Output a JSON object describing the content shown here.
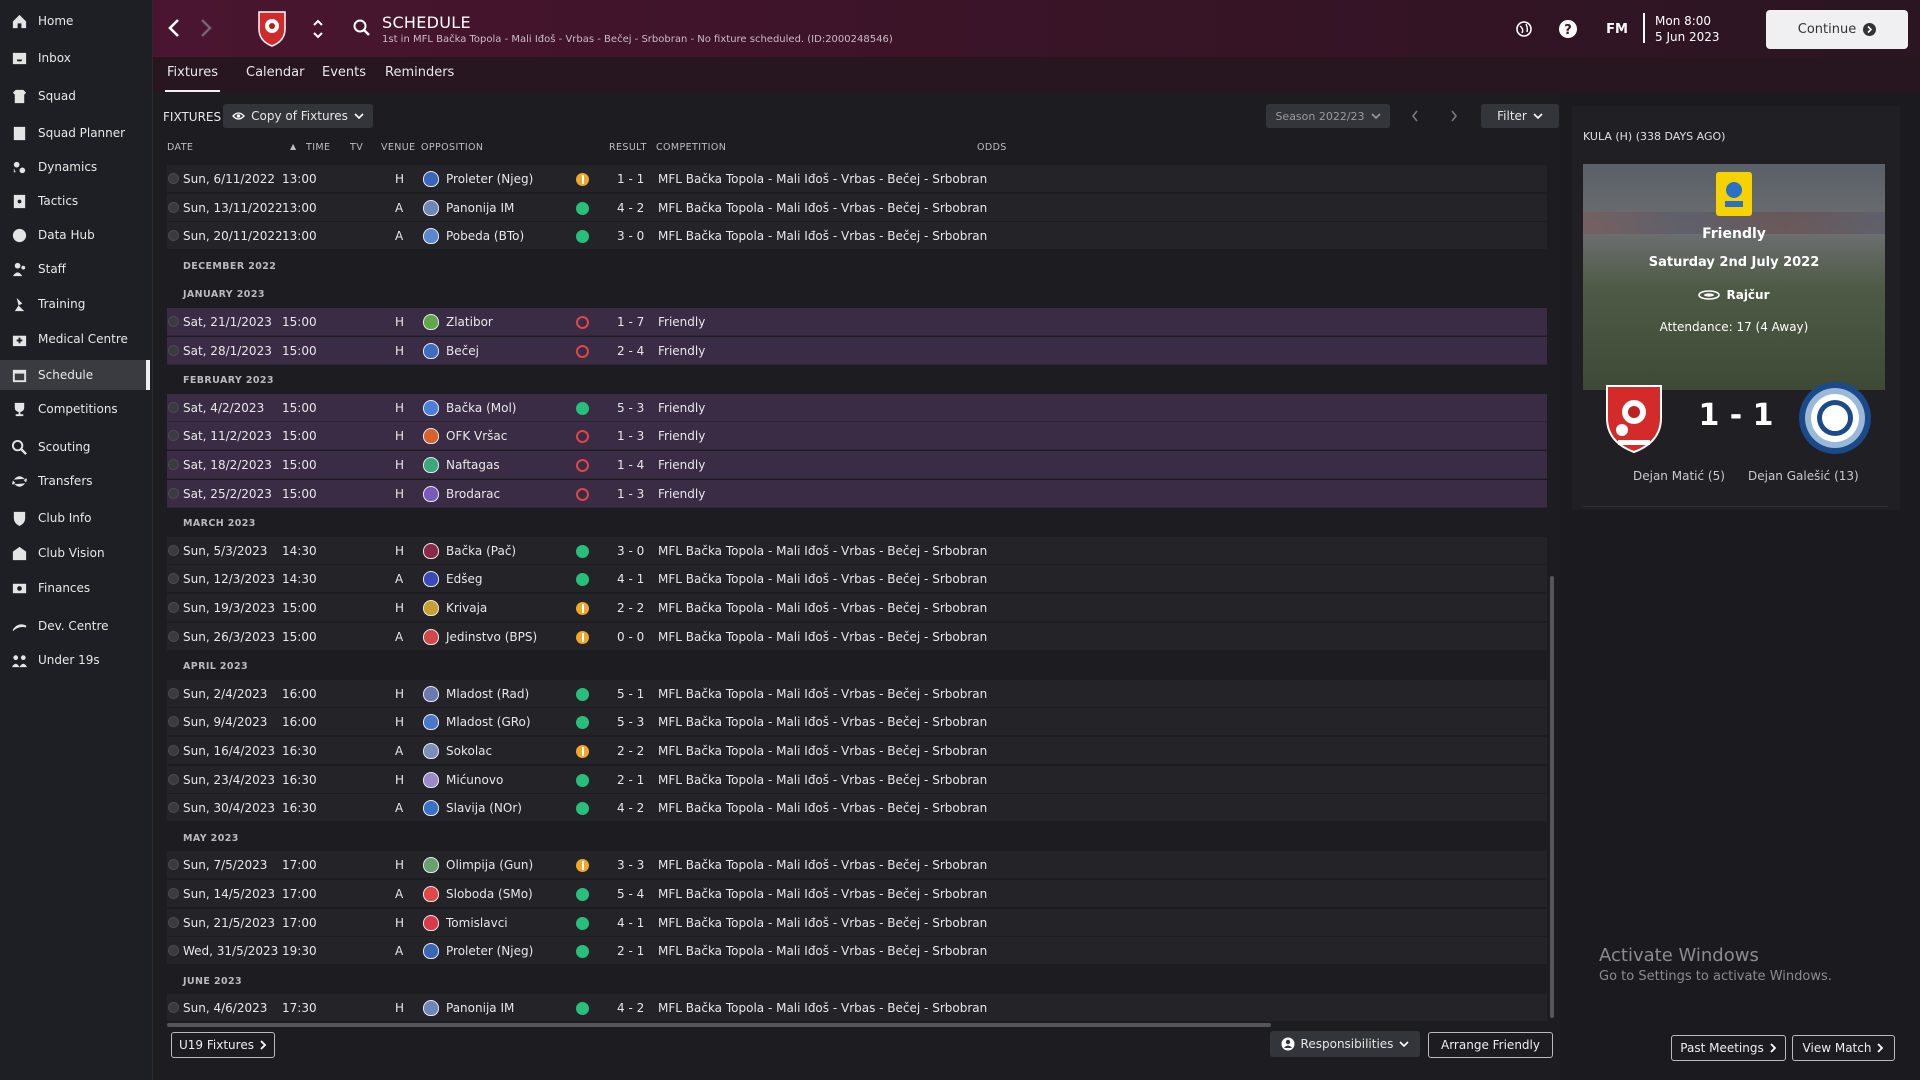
{
  "sidebar": {
    "items": [
      {
        "label": "Home",
        "icon": "home-icon"
      },
      {
        "label": "Inbox",
        "icon": "inbox-icon"
      },
      {
        "label": "Squad",
        "icon": "squad-icon"
      },
      {
        "label": "Squad Planner",
        "icon": "planner-icon"
      },
      {
        "label": "Dynamics",
        "icon": "dynamics-icon"
      },
      {
        "label": "Tactics",
        "icon": "tactics-icon"
      },
      {
        "label": "Data Hub",
        "icon": "data-hub-icon"
      },
      {
        "label": "Staff",
        "icon": "staff-icon"
      },
      {
        "label": "Training",
        "icon": "training-icon"
      },
      {
        "label": "Medical Centre",
        "icon": "medical-icon"
      },
      {
        "label": "Schedule",
        "icon": "schedule-icon",
        "active": true
      },
      {
        "label": "Competitions",
        "icon": "trophy-icon"
      },
      {
        "label": "Scouting",
        "icon": "scouting-icon"
      },
      {
        "label": "Transfers",
        "icon": "transfers-icon"
      },
      {
        "label": "Club Info",
        "icon": "club-info-icon"
      },
      {
        "label": "Club Vision",
        "icon": "club-vision-icon"
      },
      {
        "label": "Finances",
        "icon": "finances-icon"
      },
      {
        "label": "Dev. Centre",
        "icon": "dev-centre-icon"
      },
      {
        "label": "Under 19s",
        "icon": "under19-icon"
      }
    ]
  },
  "header": {
    "title": "SCHEDULE",
    "subtitle": "1st in MFL Bačka Topola - Mali Iđoš - Vrbas - Bečej - Srbobran - No fixture scheduled. (ID:2000248546)",
    "fm_label": "FM",
    "date_line1": "Mon 8:00",
    "date_line2": "5 Jun 2023",
    "continue_label": "Continue"
  },
  "tabs": [
    "Fixtures",
    "Calendar",
    "Events",
    "Reminders"
  ],
  "toolbar": {
    "fixtures_label": "FIXTURES",
    "view_select": "Copy of Fixtures",
    "season_select": "Season 2022/23",
    "filter_label": "Filter"
  },
  "columns": {
    "date": "DATE",
    "time": "TIME",
    "tv": "TV",
    "venue": "VENUE",
    "opposition": "OPPOSITION",
    "result": "RESULT",
    "competition": "COMPETITION",
    "odds": "ODDS"
  },
  "rows": [
    {
      "kind": "fixture",
      "date": "Sun, 6/11/2022",
      "time": "13:00",
      "venue": "H",
      "opp": "Proleter (Njeg)",
      "badge": "#3a66b8",
      "outcome": "draw",
      "score": "1 - 1",
      "comp": "MFL Bačka Topola - Mali Iđoš - Vrbas - Bečej - Srbobran"
    },
    {
      "kind": "fixture",
      "date": "Sun, 13/11/2022",
      "time": "13:00",
      "venue": "A",
      "opp": "Panonija IM",
      "badge": "#6f86b8",
      "outcome": "win",
      "score": "4 - 2",
      "comp": "MFL Bačka Topola - Mali Iđoš - Vrbas - Bečej - Srbobran"
    },
    {
      "kind": "fixture",
      "date": "Sun, 20/11/2022",
      "time": "13:00",
      "venue": "A",
      "opp": "Pobeda (BTo)",
      "badge": "#5a88d0",
      "outcome": "win",
      "score": "3 - 0",
      "comp": "MFL Bačka Topola - Mali Iđoš - Vrbas - Bečej - Srbobran"
    },
    {
      "kind": "month",
      "label": "DECEMBER 2022"
    },
    {
      "kind": "month",
      "label": "JANUARY 2023"
    },
    {
      "kind": "friendly",
      "date": "Sat, 21/1/2023",
      "time": "15:00",
      "venue": "H",
      "opp": "Zlatibor",
      "badge": "#5ea84a",
      "outcome": "loss",
      "score": "1 - 7",
      "comp": "Friendly"
    },
    {
      "kind": "friendly",
      "date": "Sat, 28/1/2023",
      "time": "15:00",
      "venue": "H",
      "opp": "Bečej",
      "badge": "#3f6cc0",
      "outcome": "loss",
      "score": "2 - 4",
      "comp": "Friendly"
    },
    {
      "kind": "month",
      "label": "FEBRUARY 2023"
    },
    {
      "kind": "friendly",
      "date": "Sat, 4/2/2023",
      "time": "15:00",
      "venue": "H",
      "opp": "Bačka (Mol)",
      "badge": "#4a80d8",
      "outcome": "win",
      "score": "5 - 3",
      "comp": "Friendly"
    },
    {
      "kind": "friendly",
      "date": "Sat, 11/2/2023",
      "time": "15:00",
      "venue": "H",
      "opp": "OFK Vršac",
      "badge": "#d8602a",
      "outcome": "loss",
      "score": "1 - 3",
      "comp": "Friendly"
    },
    {
      "kind": "friendly",
      "date": "Sat, 18/2/2023",
      "time": "15:00",
      "venue": "H",
      "opp": "Naftagas",
      "badge": "#3aa87a",
      "outcome": "loss",
      "score": "1 - 4",
      "comp": "Friendly"
    },
    {
      "kind": "friendly",
      "date": "Sat, 25/2/2023",
      "time": "15:00",
      "venue": "H",
      "opp": "Brodarac",
      "badge": "#7a5ab8",
      "outcome": "loss",
      "score": "1 - 3",
      "comp": "Friendly"
    },
    {
      "kind": "month",
      "label": "MARCH 2023"
    },
    {
      "kind": "fixture",
      "date": "Sun, 5/3/2023",
      "time": "14:30",
      "venue": "H",
      "opp": "Bačka (Pač)",
      "badge": "#8a2a4a",
      "outcome": "win",
      "score": "3 - 0",
      "comp": "MFL Bačka Topola - Mali Iđoš - Vrbas - Bečej - Srbobran"
    },
    {
      "kind": "fixture",
      "date": "Sun, 12/3/2023",
      "time": "14:30",
      "venue": "A",
      "opp": "Edšeg",
      "badge": "#3a4ab8",
      "outcome": "win",
      "score": "4 - 1",
      "comp": "MFL Bačka Topola - Mali Iđoš - Vrbas - Bečej - Srbobran"
    },
    {
      "kind": "fixture",
      "date": "Sun, 19/3/2023",
      "time": "15:00",
      "venue": "H",
      "opp": "Krivaja",
      "badge": "#c8a030",
      "outcome": "draw",
      "score": "2 - 2",
      "comp": "MFL Bačka Topola - Mali Iđoš - Vrbas - Bečej - Srbobran"
    },
    {
      "kind": "fixture",
      "date": "Sun, 26/3/2023",
      "time": "15:00",
      "venue": "A",
      "opp": "Jedinstvo (BPS)",
      "badge": "#d04848",
      "outcome": "draw",
      "score": "0 - 0",
      "comp": "MFL Bačka Topola - Mali Iđoš - Vrbas - Bečej - Srbobran"
    },
    {
      "kind": "month",
      "label": "APRIL 2023"
    },
    {
      "kind": "fixture",
      "date": "Sun, 2/4/2023",
      "time": "16:00",
      "venue": "H",
      "opp": "Mladost (Rad)",
      "badge": "#6a7ab0",
      "outcome": "win",
      "score": "5 - 1",
      "comp": "MFL Bačka Topola - Mali Iđoš - Vrbas - Bečej - Srbobran"
    },
    {
      "kind": "fixture",
      "date": "Sun, 9/4/2023",
      "time": "16:00",
      "venue": "H",
      "opp": "Mladost (GRo)",
      "badge": "#4a78c8",
      "outcome": "win",
      "score": "5 - 3",
      "comp": "MFL Bačka Topola - Mali Iđoš - Vrbas - Bečej - Srbobran"
    },
    {
      "kind": "fixture",
      "date": "Sun, 16/4/2023",
      "time": "16:30",
      "venue": "A",
      "opp": "Sokolac",
      "badge": "#7a90b8",
      "outcome": "draw",
      "score": "2 - 2",
      "comp": "MFL Bačka Topola - Mali Iđoš - Vrbas - Bečej - Srbobran"
    },
    {
      "kind": "fixture",
      "date": "Sun, 23/4/2023",
      "time": "16:30",
      "venue": "H",
      "opp": "Mićunovo",
      "badge": "#9a8ac8",
      "outcome": "win",
      "score": "2 - 1",
      "comp": "MFL Bačka Topola - Mali Iđoš - Vrbas - Bečej - Srbobran"
    },
    {
      "kind": "fixture",
      "date": "Sun, 30/4/2023",
      "time": "16:30",
      "venue": "A",
      "opp": "Slavija (NOr)",
      "badge": "#3a70c8",
      "outcome": "win",
      "score": "4 - 2",
      "comp": "MFL Bačka Topola - Mali Iđoš - Vrbas - Bečej - Srbobran"
    },
    {
      "kind": "month",
      "label": "MAY 2023"
    },
    {
      "kind": "fixture",
      "date": "Sun, 7/5/2023",
      "time": "17:00",
      "venue": "H",
      "opp": "Olimpija (Gun)",
      "badge": "#6aa070",
      "outcome": "draw",
      "score": "3 - 3",
      "comp": "MFL Bačka Topola - Mali Iđoš - Vrbas - Bečej - Srbobran"
    },
    {
      "kind": "fixture",
      "date": "Sun, 14/5/2023",
      "time": "17:00",
      "venue": "A",
      "opp": "Sloboda (SMo)",
      "badge": "#e04848",
      "outcome": "win",
      "score": "5 - 4",
      "comp": "MFL Bačka Topola - Mali Iđoš - Vrbas - Bečej - Srbobran"
    },
    {
      "kind": "fixture",
      "date": "Sun, 21/5/2023",
      "time": "17:00",
      "venue": "H",
      "opp": "Tomislavci",
      "badge": "#d83a4a",
      "outcome": "win",
      "score": "4 - 1",
      "comp": "MFL Bačka Topola - Mali Iđoš - Vrbas - Bečej - Srbobran"
    },
    {
      "kind": "fixture",
      "date": "Wed, 31/5/2023",
      "time": "19:30",
      "venue": "A",
      "opp": "Proleter (Njeg)",
      "badge": "#3a66b8",
      "outcome": "win",
      "score": "2 - 1",
      "comp": "MFL Bačka Topola - Mali Iđoš - Vrbas - Bečej - Srbobran"
    },
    {
      "kind": "month",
      "label": "JUNE 2023"
    },
    {
      "kind": "fixture",
      "date": "Sun, 4/6/2023",
      "time": "17:30",
      "venue": "H",
      "opp": "Panonija IM",
      "badge": "#6f86b8",
      "outcome": "win",
      "score": "4 - 2",
      "comp": "MFL Bačka Topola - Mali Iđoš - Vrbas - Bečej - Srbobran"
    }
  ],
  "footer": {
    "u19_label": "U19 Fixtures",
    "responsibilities_label": "Responsibilities",
    "arrange_label": "Arrange Friendly"
  },
  "match_panel": {
    "heading": "KULA (H) (338 DAYS AGO)",
    "competition": "Friendly",
    "date": "Saturday 2nd July 2022",
    "venue": "Rajčur",
    "attendance": "Attendance: 17 (4 Away)",
    "score": "1 - 1",
    "home_scorer": "Dejan Matić (5)",
    "away_scorer": "Dejan Galešić (13)",
    "past_meetings_label": "Past Meetings",
    "view_match_label": "View Match"
  },
  "watermark": {
    "title": "Activate Windows",
    "subtitle": "Go to Settings to activate Windows."
  },
  "colors": {
    "header_bg": "#4a1530",
    "friendly_row": "#3a2c44",
    "win": "#27c07a",
    "draw": "#f0a828",
    "loss": "#e0454a"
  }
}
